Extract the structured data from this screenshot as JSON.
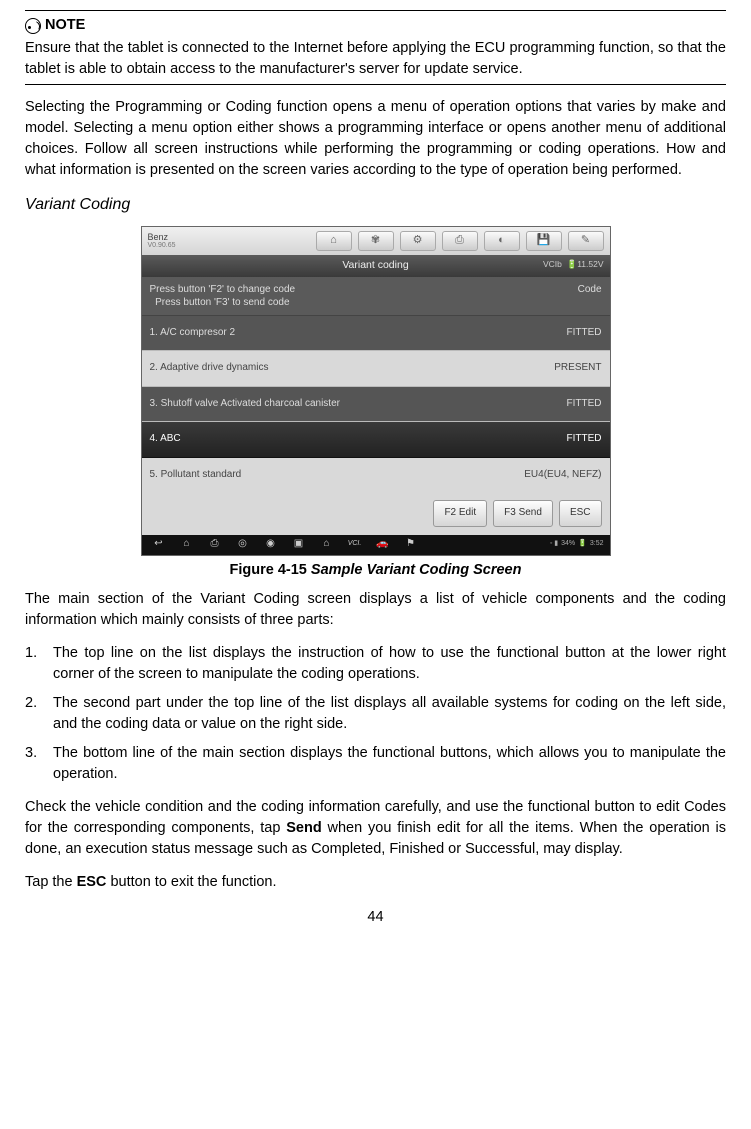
{
  "note": {
    "label": "NOTE",
    "body": "Ensure that the tablet is connected to the Internet before applying the ECU programming function, so that the tablet is able to obtain access to the manufacturer's server for update service."
  },
  "intro_para": "Selecting the Programming or Coding function opens a menu of operation options that varies by make and model. Selecting a menu option either shows a programming interface or opens another menu of additional choices. Follow all screen instructions while performing the programming or coding operations. How and what information is presented on the screen varies according to the type of operation being performed.",
  "subheading": "Variant Coding",
  "screenshot": {
    "brand": "Benz",
    "version": "V0.90.65",
    "title": "Variant coding",
    "vci_label": "VCIb",
    "voltage": "11.52V",
    "instructions_l1": "Press button 'F2' to change code",
    "instructions_l2": "Press button 'F3' to send code",
    "code_header": "Code",
    "rows": [
      {
        "label": "1. A/C compresor 2",
        "value": "FITTED"
      },
      {
        "label": "2. Adaptive drive dynamics",
        "value": "PRESENT"
      },
      {
        "label": "3. Shutoff valve Activated charcoal canister",
        "value": "FITTED"
      },
      {
        "label": "4. ABC",
        "value": "FITTED"
      },
      {
        "label": "5. Pollutant standard",
        "value": "EU4(EU4, NEFZ)"
      }
    ],
    "buttons": {
      "f2": "F2 Edit",
      "f3": "F3 Send",
      "esc": "ESC"
    },
    "status": {
      "battery": "34%",
      "time": "3:52"
    }
  },
  "caption_prefix": "Figure 4-15 ",
  "caption_title": "Sample Variant Coding Screen",
  "after_fig": "The main section of the Variant Coding screen displays a list of vehicle components and the coding information which mainly consists of three parts:",
  "list": {
    "i1": "The top line on the list displays the instruction of how to use the functional button at the lower right corner of the screen to manipulate the coding operations.",
    "i2": "The second part under the top line of the list displays all available systems for coding on the left side, and the coding data or value on the right side.",
    "i3": "The bottom line of the main section displays the functional buttons, which allows you to manipulate the operation."
  },
  "check_para_1": "Check the vehicle condition and the coding information carefully, and use the functional button to edit Codes for the corresponding components, tap ",
  "send_word": "Send",
  "check_para_2": " when you finish edit for all the items. When the operation is done, an execution status message such as Completed, Finished or Successful, may display.",
  "esc_para_1": "Tap the ",
  "esc_word": "ESC",
  "esc_para_2": " button to exit the function.",
  "page_number": "44"
}
